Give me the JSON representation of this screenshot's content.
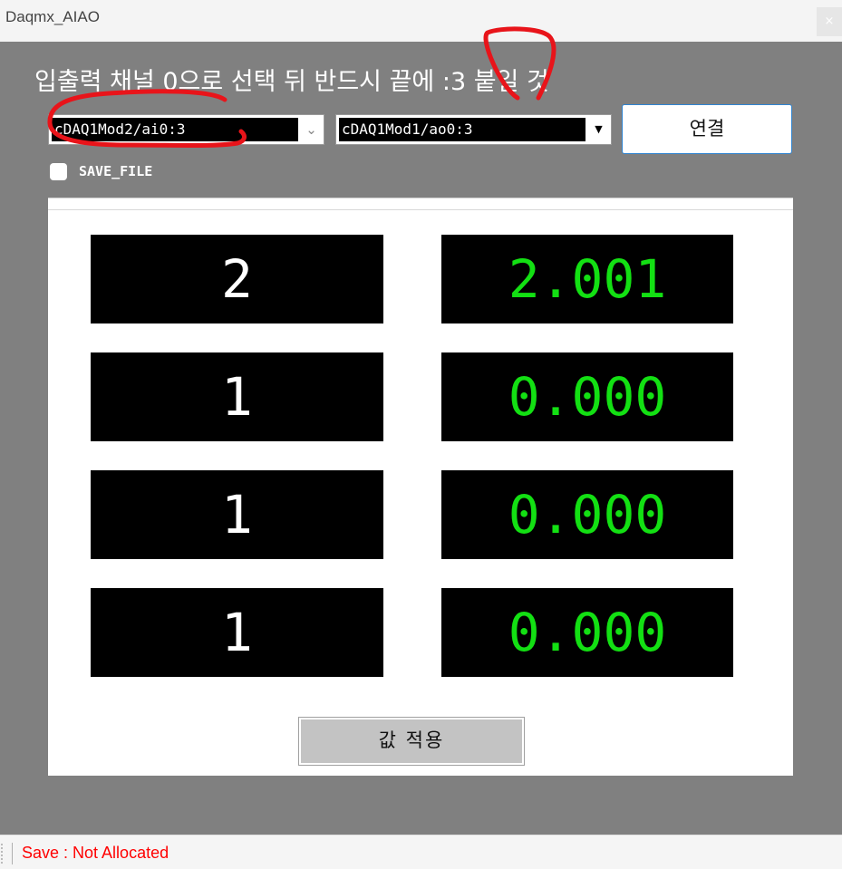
{
  "window": {
    "title": "Daqmx_AIAO",
    "close_glyph": "×"
  },
  "heading": "입출력 채널 0으로 선택 뒤 반드시 끝에 :3 붙일 것",
  "input_channel": {
    "value": "cDAQ1Mod2/ai0:3",
    "arrow_icon": "chevron-down-icon"
  },
  "output_channel": {
    "value": "cDAQ1Mod1/ao0:3",
    "arrow_icon": "dropdown-triangle-icon"
  },
  "connect_button": "연결",
  "save_file": {
    "label": "SAVE_FILE",
    "checked": false
  },
  "displays": {
    "left": [
      "2",
      "1",
      "1",
      "1"
    ],
    "right": [
      "2.001",
      "0.000",
      "0.000",
      "0.000"
    ]
  },
  "apply_button": "값 적용",
  "status": "Save : Not Allocated",
  "colors": {
    "background": "#808080",
    "display_background": "#000000",
    "left_value_text": "#ffffff",
    "right_value_text": "#13e013",
    "status_text": "#ff0000",
    "annotation_marks": "#e8141a",
    "connect_border": "#2f84d1"
  }
}
